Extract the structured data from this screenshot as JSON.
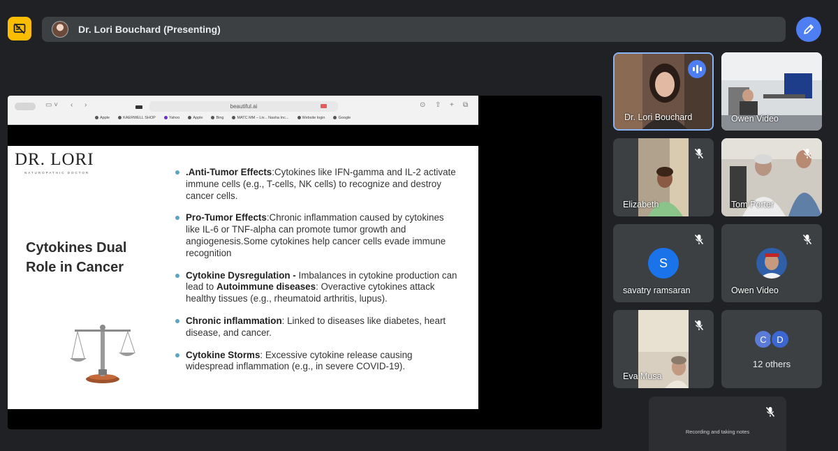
{
  "meeting": {
    "presenter_label": "Dr. Lori Bouchard (Presenting)"
  },
  "browser": {
    "url": "beautiful.ai",
    "bookmarks": [
      "Apple",
      "KAERWELL SHOP",
      "Yahoo",
      "Apple",
      "Bing",
      "MATC MM – Liv...",
      "Nasha Inc...",
      "Website login",
      "Google"
    ]
  },
  "slide": {
    "logo": "DR. LORI",
    "logo_subtitle": "NATUROPATHIC DOCTOR",
    "title": "Cytokines Dual Role in Cancer",
    "bullets": [
      {
        "bold": ".Anti-Tumor Effects",
        "text": ":Cytokines like IFN-gamma and IL-2 activate immune cells (e.g., T-cells, NK cells) to recognize and destroy cancer cells."
      },
      {
        "bold": "Pro-Tumor Effects",
        "text": ":Chronic inflammation caused by cytokines like IL-6 or TNF-alpha can promote tumor growth and angiogenesis.Some cytokines help cancer cells evade immune recognition"
      },
      {
        "bold": "Cytokine Dysregulation -",
        "text": " Imbalances in cytokine production can lead to ",
        "bold2": "Autoimmune diseases",
        "text2": ": Overactive cytokines attack healthy tissues (e.g., rheumatoid arthritis, lupus)."
      },
      {
        "bold": "Chronic inflammation",
        "text": ": Linked to diseases like diabetes, heart disease, and cancer."
      },
      {
        "bold": "Cytokine Storms",
        "text": ": Excessive cytokine release causing widespread inflammation (e.g., in severe COVID-19)."
      }
    ]
  },
  "participants": [
    {
      "name": "Dr. Lori Bouchard",
      "speaking": true
    },
    {
      "name": "Owen Video",
      "muted": false
    },
    {
      "name": "Elizabeth",
      "muted": true
    },
    {
      "name": "Tom Porter",
      "muted": true
    },
    {
      "name": "savatry ramsaran",
      "muted": true,
      "initial": "S"
    },
    {
      "name": "Owen Video",
      "muted": true
    },
    {
      "name": "Eva Musa",
      "muted": true
    }
  ],
  "others": {
    "initials": [
      "C",
      "D"
    ],
    "label": "12 others"
  },
  "notes_tile": {
    "label": "Recording and taking notes"
  },
  "icons": {
    "present_toggle": "present-off-icon",
    "pen": "pen-icon",
    "mic_off": "mic-off-icon",
    "speaking": "audio-bars-icon"
  },
  "colors": {
    "background": "#202124",
    "tile": "#3c4043",
    "accent_blue": "#4d7ff3",
    "present_yellow": "#fbbc04",
    "bullet_dot": "#5aa6c2"
  }
}
